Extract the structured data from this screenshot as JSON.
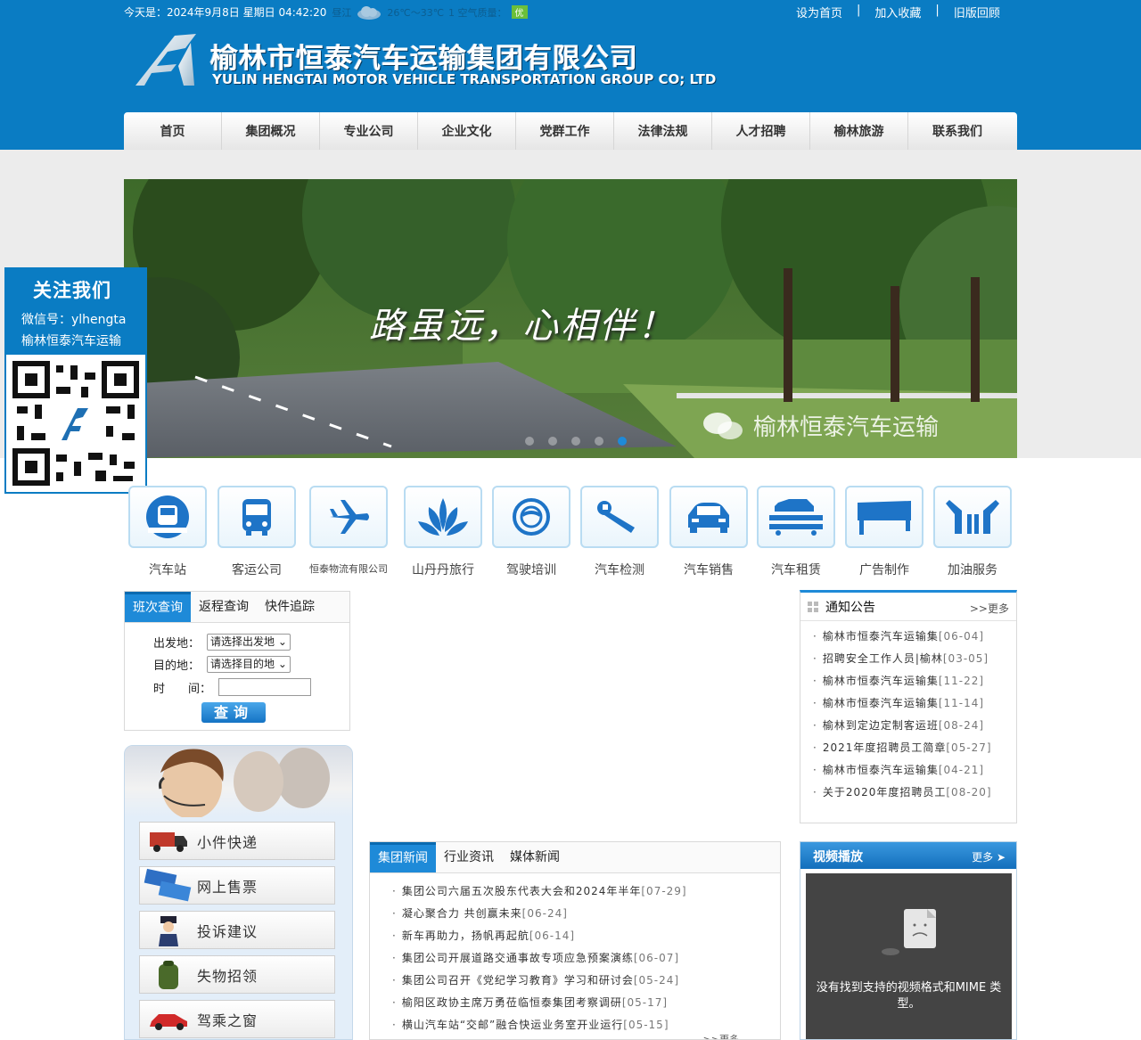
{
  "topbar": {
    "date_text": "今天是：2024年9月8日  星期日  04:42:20",
    "city": "昼江",
    "temperature": "26℃～33℃",
    "air_quality_label": "1 空气质量：",
    "air_quality_value": "优",
    "links": [
      "设为首页",
      "加入收藏",
      "旧版回顾"
    ]
  },
  "logo": {
    "cn": "榆林市恒泰汽车运输集团有限公司",
    "en": "YULIN HENGTAI MOTOR VEHICLE TRANSPORTATION GROUP CO; LTD"
  },
  "nav": [
    "首页",
    "集团概况",
    "专业公司",
    "企业文化",
    "党群工作",
    "法律法规",
    "人才招聘",
    "榆林旅游",
    "联系我们"
  ],
  "banner": {
    "slogan": "路虽远，心相伴！",
    "watermark": "榆林恒泰汽车运输",
    "slide_count": 5,
    "active_slide": 5
  },
  "follow": {
    "title": "关注我们",
    "wechat": "微信号：ylhengta",
    "name": "榆林恒泰汽车运输"
  },
  "services": [
    {
      "label": "汽车站",
      "icon": "bus-station-icon"
    },
    {
      "label": "客运公司",
      "icon": "bus-icon"
    },
    {
      "label": "恒泰物流有限公司",
      "icon": "airplane-icon"
    },
    {
      "label": "山丹丹旅行",
      "icon": "lotus-icon"
    },
    {
      "label": "驾驶培训",
      "icon": "steering-wheel-icon"
    },
    {
      "label": "汽车检测",
      "icon": "wrench-icon"
    },
    {
      "label": "汽车销售",
      "icon": "car-icon"
    },
    {
      "label": "汽车租赁",
      "icon": "car-carrier-icon"
    },
    {
      "label": "广告制作",
      "icon": "billboard-icon"
    },
    {
      "label": "加油服务",
      "icon": "fuel-nozzle-icon"
    }
  ],
  "query": {
    "tabs": [
      "班次查询",
      "返程查询",
      "快件追踪"
    ],
    "from_label": "出发地：",
    "from_value": "请选择出发地",
    "to_label": "目的地：",
    "to_value": "请选择目的地",
    "time_label": "时　　间：",
    "button": "查询"
  },
  "service_panel": [
    "小件快递",
    "网上售票",
    "投诉建议",
    "失物招领",
    "驾乘之窗"
  ],
  "notices": {
    "title": "通知公告",
    "more": ">>更多",
    "items": [
      {
        "text": "榆林市恒泰汽车运输集",
        "date": "[06-04]"
      },
      {
        "text": "招聘安全工作人员|榆林",
        "date": "[03-05]"
      },
      {
        "text": "榆林市恒泰汽车运输集",
        "date": "[11-22]"
      },
      {
        "text": "榆林市恒泰汽车运输集",
        "date": "[11-14]"
      },
      {
        "text": "榆林到定边定制客运班",
        "date": "[08-24]"
      },
      {
        "text": "2021年度招聘员工简章",
        "date": "[05-27]"
      },
      {
        "text": "榆林市恒泰汽车运输集",
        "date": "[04-21]"
      },
      {
        "text": "关于2020年度招聘员工",
        "date": "[08-20]"
      }
    ]
  },
  "news": {
    "tabs": [
      "集团新闻",
      "行业资讯",
      "媒体新闻"
    ],
    "more": ">>更多",
    "items": [
      {
        "text": "集团公司六届五次股东代表大会和2024年半年",
        "date": "[07-29]"
      },
      {
        "text": "凝心聚合力 共创赢未来",
        "date": "[06-24]"
      },
      {
        "text": "新车再助力，扬帆再起航",
        "date": "[06-14]"
      },
      {
        "text": "集团公司开展道路交通事故专项应急预案演练",
        "date": "[06-07]"
      },
      {
        "text": "集团公司召开《党纪学习教育》学习和研讨会",
        "date": "[05-24]"
      },
      {
        "text": "榆阳区政协主席万勇莅临恒泰集团考察调研",
        "date": "[05-17]"
      },
      {
        "text": "横山汽车站“交邮”融合快运业务室开业运行",
        "date": "[05-15]"
      }
    ]
  },
  "video": {
    "title": "视频播放",
    "more": "更多",
    "message": "没有找到支持的视频格式和MIME 类型。"
  }
}
